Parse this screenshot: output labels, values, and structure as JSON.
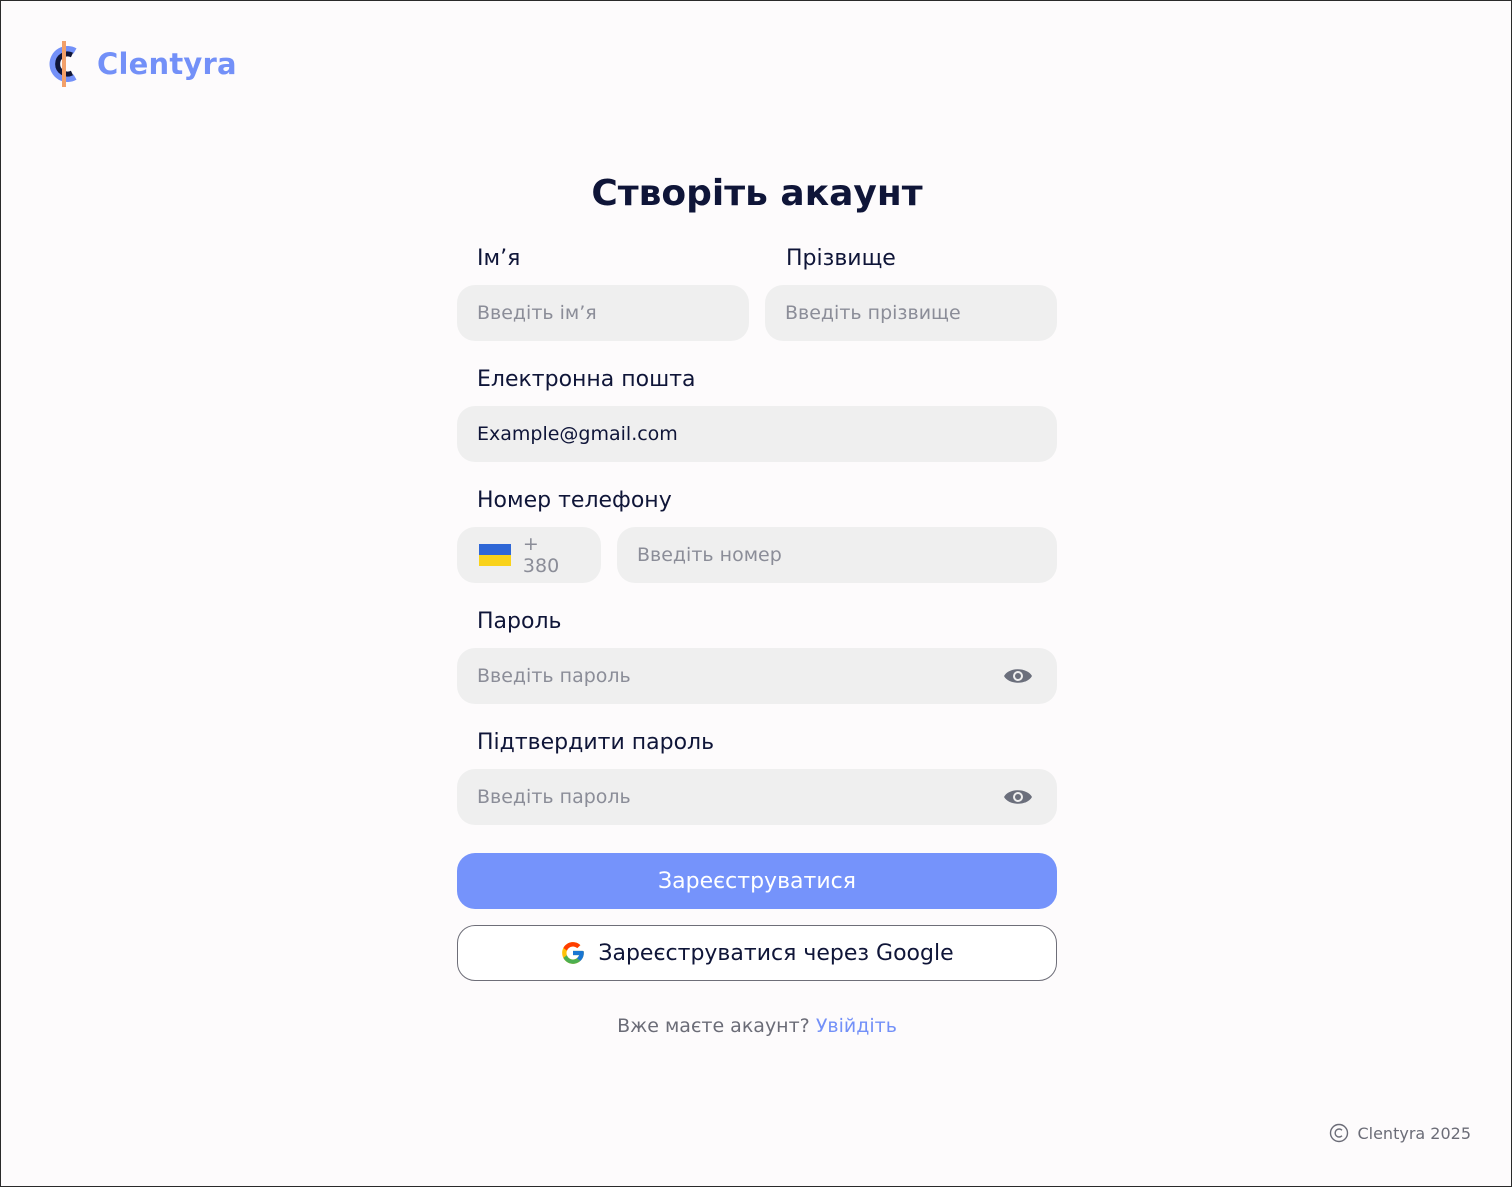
{
  "brand": {
    "name": "Clentyra",
    "accent": "#7390f8"
  },
  "page": {
    "title": "Створіть акаунт"
  },
  "form": {
    "first_name": {
      "label": "Ім’я",
      "placeholder": "Введіть ім’я"
    },
    "last_name": {
      "label": "Прізвище",
      "placeholder": "Введіть прізвище"
    },
    "email": {
      "label": "Електронна пошта",
      "value": "Example@gmail.com"
    },
    "phone": {
      "label": "Номер телефону",
      "country_code": "+ 380",
      "country_flag": "ukraine-flag-icon",
      "placeholder": "Введіть номер"
    },
    "password": {
      "label": "Пароль",
      "placeholder": "Введіть пароль",
      "toggle_icon": "eye-icon"
    },
    "confirm_password": {
      "label": "Підтвердити пароль",
      "placeholder": "Введіть пароль",
      "toggle_icon": "eye-icon"
    },
    "submit_label": "Зареєструватися",
    "google_label": "Зареєструватися через Google",
    "google_icon": "google-icon",
    "signin_prompt": "Вже маєте акаунт?",
    "signin_link": "Увійдіть"
  },
  "footer": {
    "copyright": "Clentyra 2025",
    "icon": "copyright-icon"
  },
  "colors": {
    "primary": "#7593fb",
    "field_bg": "#efefef",
    "text": "#0f1538",
    "muted": "#8b8d98",
    "background": "#fdfbfc"
  }
}
